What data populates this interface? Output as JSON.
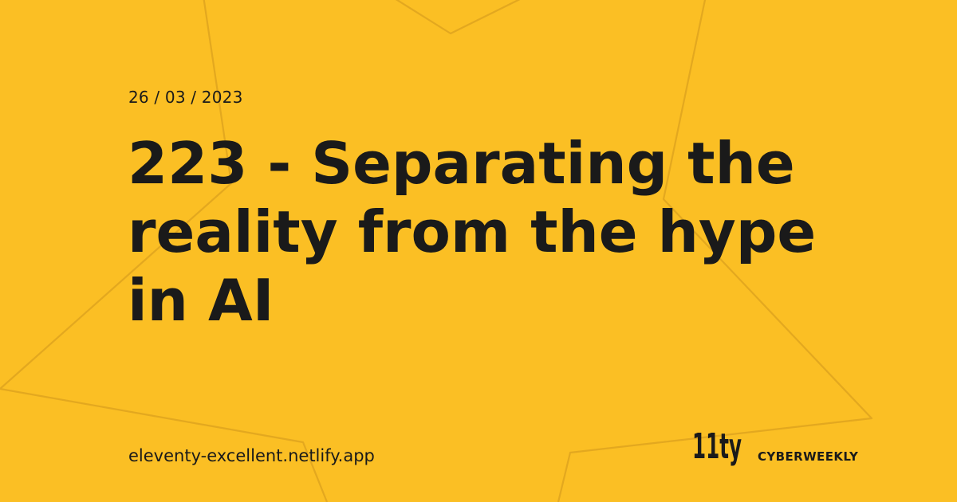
{
  "colors": {
    "background": "#FBBF24",
    "text": "#1A1A1A",
    "star_outline": "#E0A51F"
  },
  "post": {
    "date": "26 / 03 / 2023",
    "title": "223 - Separating the reality from the hype in AI"
  },
  "footer": {
    "site_url": "eleventy-excellent.netlify.app",
    "logo_text": "11ty",
    "brand_name": "CYBERWEEKLY"
  }
}
